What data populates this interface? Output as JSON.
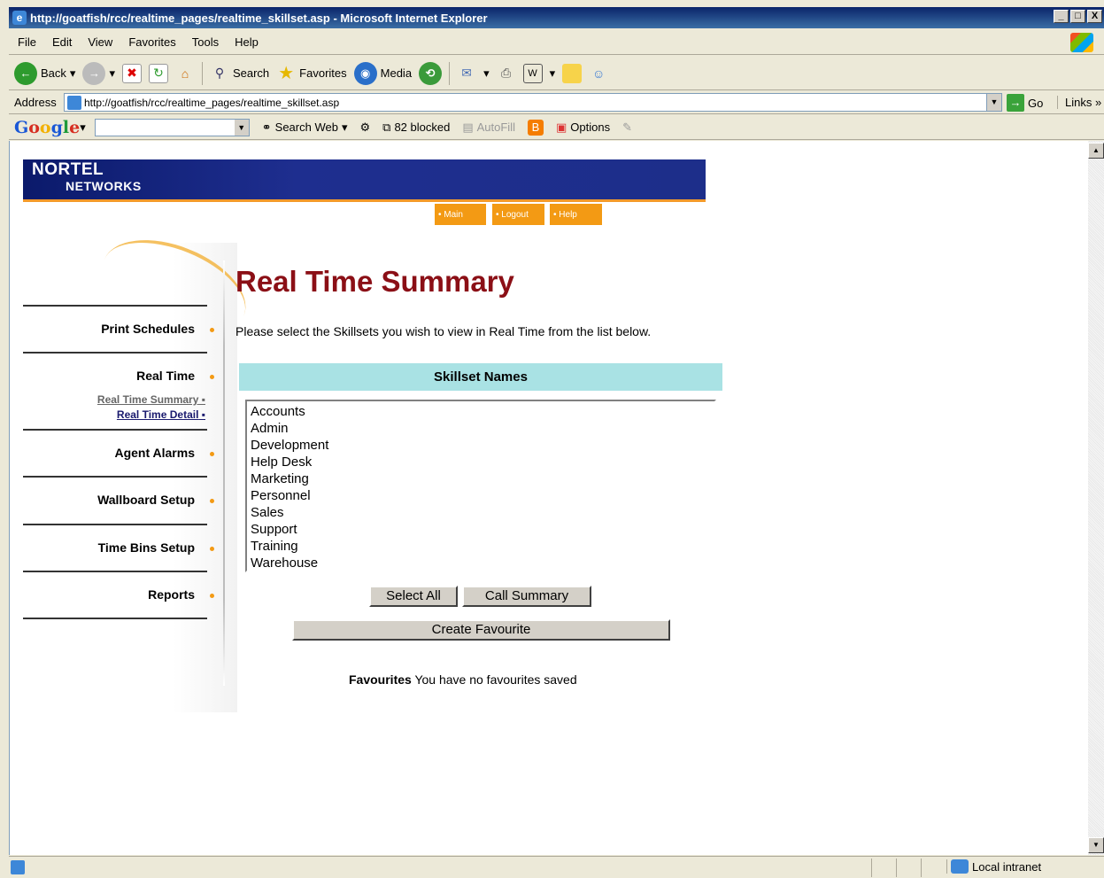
{
  "window": {
    "title": "http://goatfish/rcc/realtime_pages/realtime_skillset.asp - Microsoft Internet Explorer",
    "min": "_",
    "max": "□",
    "close": "X"
  },
  "menu": [
    "File",
    "Edit",
    "View",
    "Favorites",
    "Tools",
    "Help"
  ],
  "toolbar": {
    "back": "Back",
    "search": "Search",
    "favorites": "Favorites",
    "media": "Media"
  },
  "address": {
    "label": "Address",
    "url": "http://goatfish/rcc/realtime_pages/realtime_skillset.asp",
    "go": "Go",
    "links": "Links"
  },
  "google": {
    "search_web": "Search Web",
    "blocked": "82 blocked",
    "autofill": "AutoFill",
    "options": "Options"
  },
  "brand": {
    "name": "NORTEL",
    "sub": "NETWORKS"
  },
  "topnav": [
    "• Main",
    "• Logout",
    "• Help"
  ],
  "sidebar": {
    "items": [
      "Print Schedules",
      "Real Time",
      "Agent Alarms",
      "Wallboard Setup",
      "Time Bins Setup",
      "Reports"
    ],
    "sublinks": [
      "Real Time Summary",
      "Real Time Detail"
    ]
  },
  "main": {
    "title": "Real Time Summary",
    "intro": "Please select the Skillsets you wish to view in Real Time from the list below.",
    "list_header": "Skillset Names",
    "skillsets": [
      "Accounts",
      "Admin",
      "Development",
      "Help Desk",
      "Marketing",
      "Personnel",
      "Sales",
      "Support",
      "Training",
      "Warehouse"
    ],
    "buttons": {
      "select_all": "Select All",
      "call_summary": "Call Summary",
      "create_favourite": "Create Favourite"
    },
    "favourites_label": "Favourites",
    "favourites_text": "You have no favourites saved"
  },
  "status": {
    "zone": "Local intranet"
  },
  "colors": {
    "title_red": "#8b0f16",
    "accent_orange": "#f39a14",
    "header_teal": "#a9e2e4",
    "banner_blue": "#1e2e8f"
  }
}
